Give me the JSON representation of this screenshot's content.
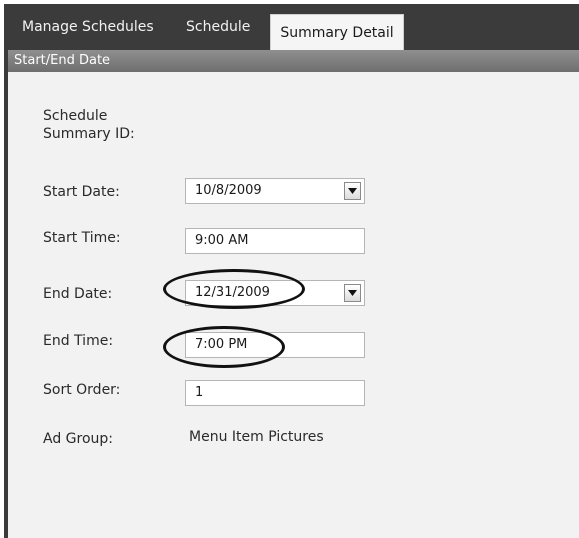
{
  "tabs": [
    {
      "label": "Manage Schedules"
    },
    {
      "label": "Schedule"
    },
    {
      "label": "Summary Detail"
    }
  ],
  "section": {
    "title": "Start/End Date"
  },
  "form": {
    "summary_id": {
      "label_line1": "Schedule",
      "label_line2": "Summary ID:"
    },
    "start_date": {
      "label": "Start Date:",
      "value": "10/8/2009"
    },
    "start_time": {
      "label": "Start Time:",
      "value": "9:00 AM"
    },
    "end_date": {
      "label": "End Date:",
      "value": "12/31/2009"
    },
    "end_time": {
      "label": "End Time:",
      "value": "7:00 PM"
    },
    "sort_order": {
      "label": "Sort Order:",
      "value": "1"
    },
    "ad_group": {
      "label": "Ad Group:",
      "value": "Menu Item Pictures"
    }
  },
  "icons": {
    "dropdown": "chevron-down-icon"
  },
  "colors": {
    "tab_bar": "#3b3b3b",
    "panel": "#f2f2f2",
    "header": "#7f7f7f",
    "annotation": "#111111"
  }
}
